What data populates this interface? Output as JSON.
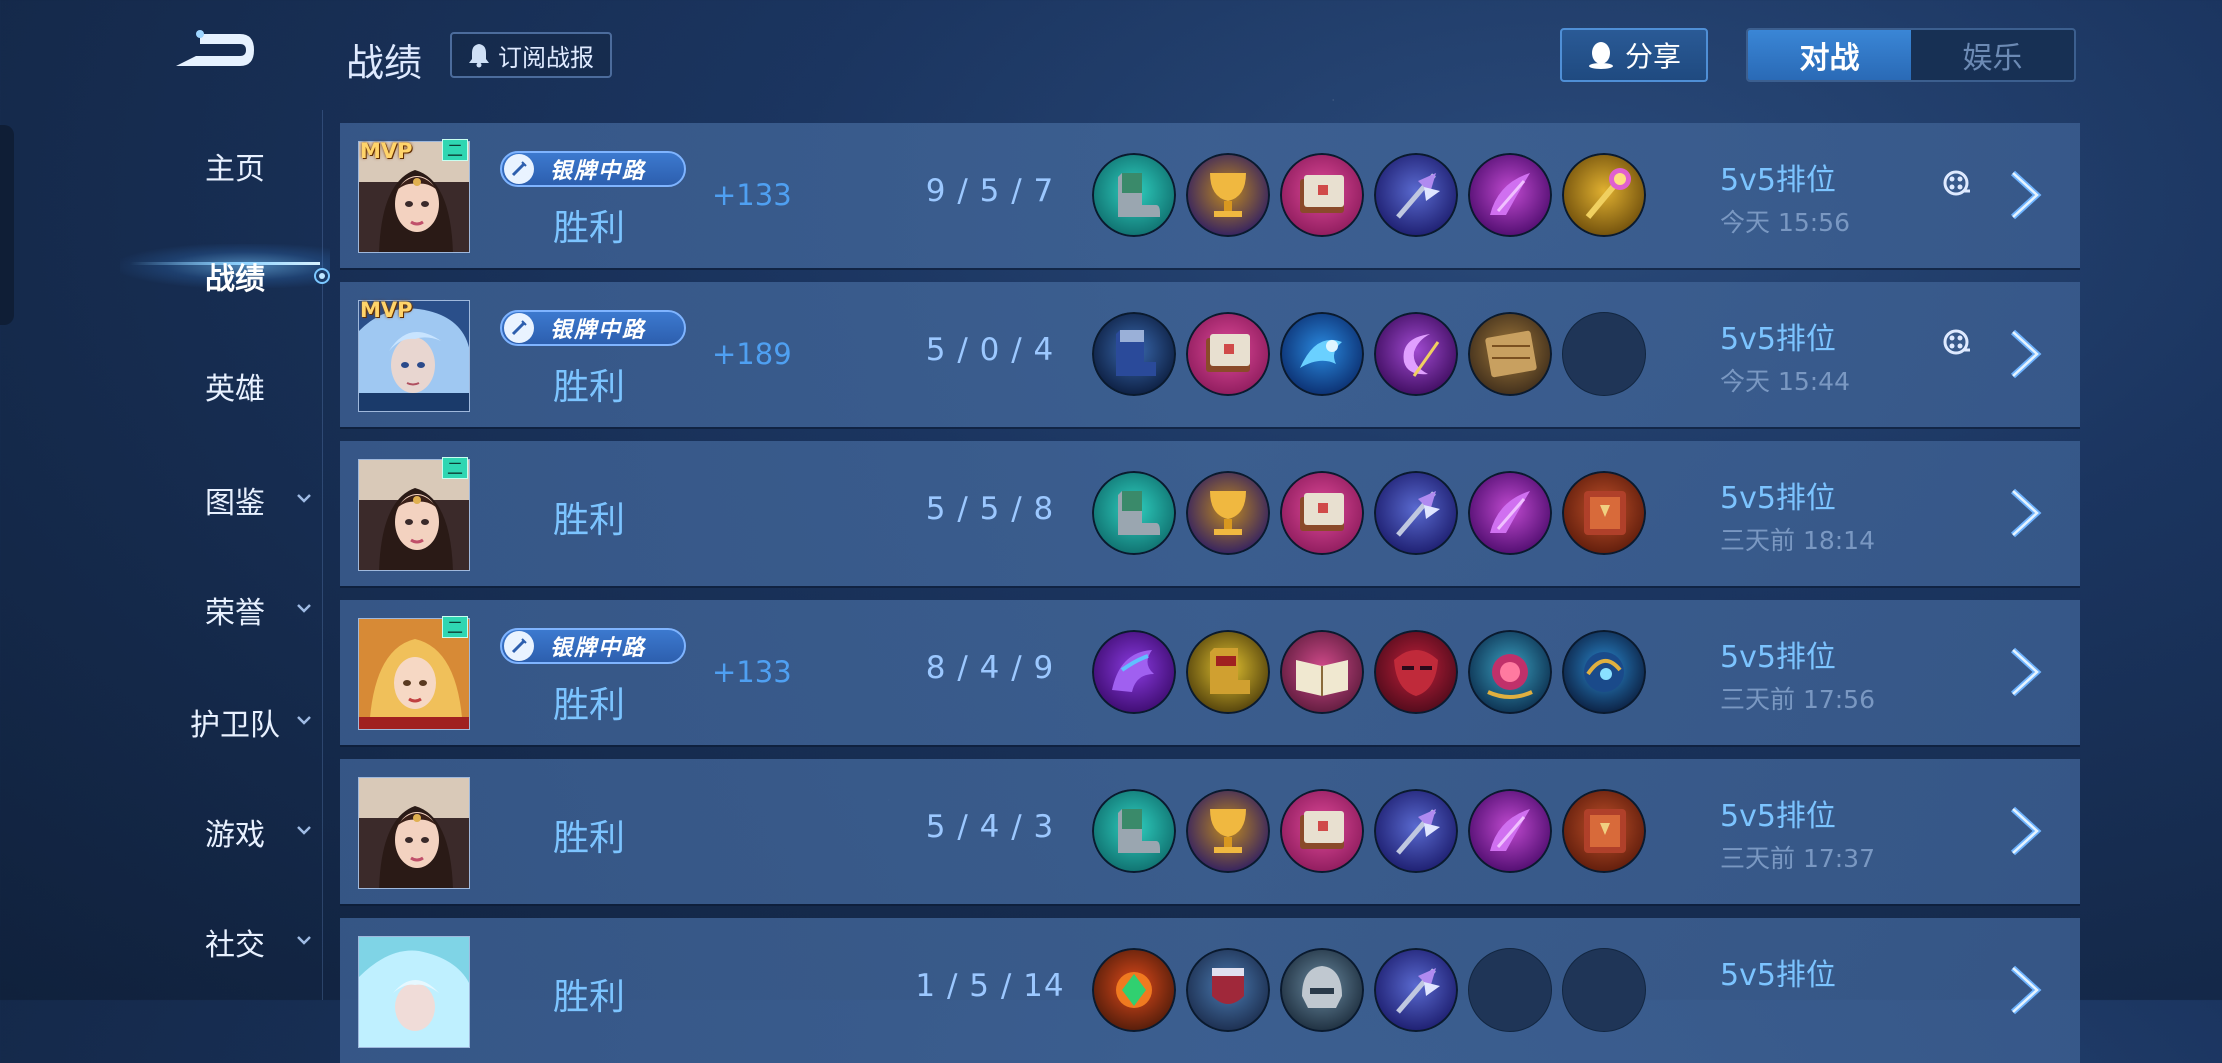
{
  "header": {
    "title": "战绩",
    "subscribe_label": "订阅战报",
    "share_label": "分享",
    "tabs": [
      {
        "label": "对战",
        "active": true
      },
      {
        "label": "娱乐",
        "active": false
      }
    ]
  },
  "sidebar": {
    "items": [
      {
        "label": "主页",
        "active": false,
        "has_chevron": false
      },
      {
        "label": "战绩",
        "active": true,
        "has_chevron": false
      },
      {
        "label": "英雄",
        "active": false,
        "has_chevron": false
      },
      {
        "label": "图鉴",
        "active": false,
        "has_chevron": true
      },
      {
        "label": "荣誉",
        "active": false,
        "has_chevron": true
      },
      {
        "label": "护卫队",
        "active": false,
        "has_chevron": true
      },
      {
        "label": "游戏",
        "active": false,
        "has_chevron": true
      },
      {
        "label": "社交",
        "active": false,
        "has_chevron": true
      }
    ]
  },
  "matches": [
    {
      "mvp_label": "MVP",
      "rank_tier": "二",
      "badge_text": "银牌中路",
      "result": "胜利",
      "points": "+133",
      "kda": "9 / 5 / 7",
      "mode": "5v5排位",
      "time": "今天 15:56",
      "has_replay": true,
      "hero": "hero-a",
      "items": [
        "boots-item-icon",
        "golden-chalice-item-icon",
        "spellbook-item-icon",
        "winged-staff-item-icon",
        "purple-blade-item-icon",
        "golden-scepter-item-icon"
      ]
    },
    {
      "mvp_label": "MVP",
      "rank_tier": "",
      "badge_text": "银牌中路",
      "result": "胜利",
      "points": "+189",
      "kda": "5 / 0 / 4",
      "mode": "5v5排位",
      "time": "今天 15:44",
      "has_replay": true,
      "hero": "hero-b",
      "items": [
        "blue-boots-item-icon",
        "spellbook-item-icon",
        "blue-wave-item-icon",
        "purple-crescent-item-icon",
        "wooden-shield-item-icon",
        "empty-slot"
      ]
    },
    {
      "mvp_label": "",
      "rank_tier": "二",
      "badge_text": "",
      "result": "胜利",
      "points": "",
      "kda": "5 / 5 / 8",
      "mode": "5v5排位",
      "time": "三天前 18:14",
      "has_replay": false,
      "hero": "hero-a",
      "items": [
        "boots-item-icon",
        "golden-chalice-item-icon",
        "spellbook-item-icon",
        "winged-staff-item-icon",
        "purple-blade-item-icon",
        "red-tome-item-icon"
      ]
    },
    {
      "mvp_label": "",
      "rank_tier": "二",
      "badge_text": "银牌中路",
      "result": "胜利",
      "points": "+133",
      "kda": "8 / 4 / 9",
      "mode": "5v5排位",
      "time": "三天前 17:56",
      "has_replay": false,
      "hero": "hero-c",
      "items": [
        "purple-dragon-item-icon",
        "golden-boots-item-icon",
        "open-book-item-icon",
        "red-mask-item-icon",
        "ruby-orb-item-icon",
        "blue-orb-item-icon"
      ]
    },
    {
      "mvp_label": "",
      "rank_tier": "",
      "badge_text": "",
      "result": "胜利",
      "points": "",
      "kda": "5 / 4 / 3",
      "mode": "5v5排位",
      "time": "三天前 17:37",
      "has_replay": false,
      "hero": "hero-a",
      "items": [
        "boots-item-icon",
        "golden-chalice-item-icon",
        "spellbook-item-icon",
        "winged-staff-item-icon",
        "purple-blade-item-icon",
        "red-tome-item-icon"
      ]
    },
    {
      "mvp_label": "",
      "rank_tier": "",
      "badge_text": "",
      "result": "胜利",
      "points": "",
      "kda": "1 / 5 / 14",
      "mode": "5v5排位",
      "time": "",
      "has_replay": false,
      "hero": "hero-d",
      "items": [
        "green-gem-item-icon",
        "red-armor-item-icon",
        "steel-helm-item-icon",
        "winged-staff-item-icon",
        "empty-slot",
        "empty-slot"
      ]
    }
  ]
}
